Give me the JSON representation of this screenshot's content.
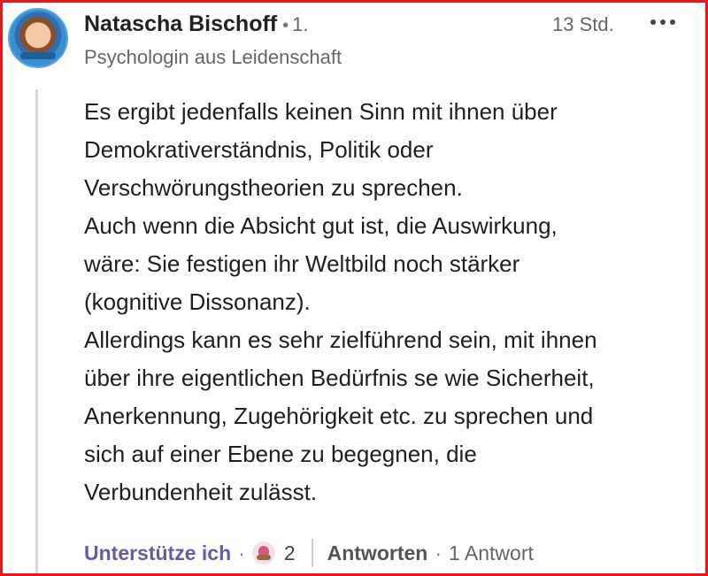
{
  "comment": {
    "author": "Natascha Bischoff",
    "separator": "•",
    "degree": "1.",
    "time": "13 Std.",
    "headline": "Psychologin aus Leidenschaft",
    "body_lines": [
      "Es ergibt jedenfalls keinen Sinn mit ihnen über",
      "Demokrativerständnis, Politik oder",
      "Verschwörungstheorien zu sprechen.",
      "Auch wenn die Absicht gut ist, die Auswirkung,",
      "wäre: Sie festigen ihr Weltbild noch stärker",
      "(kognitive Dissonanz).",
      "Allerdings kann es sehr zielführend sein, mit ihnen",
      "über ihre eigentlichen Bedürfnis se wie Sicherheit,",
      "Anerkennung, Zugehörigkeit etc. zu sprechen und",
      "sich auf einer Ebene zu begegnen, die",
      "Verbundenheit zulässt."
    ],
    "actions": {
      "support_label": "Unterstütze ich",
      "dot": "·",
      "reaction_icon": "support-reaction-icon",
      "reaction_count": "2",
      "reply_label": "Antworten",
      "replies_label": "1 Antwort"
    }
  },
  "colors": {
    "frame": "#e8171a",
    "support": "#6a5aa3"
  }
}
